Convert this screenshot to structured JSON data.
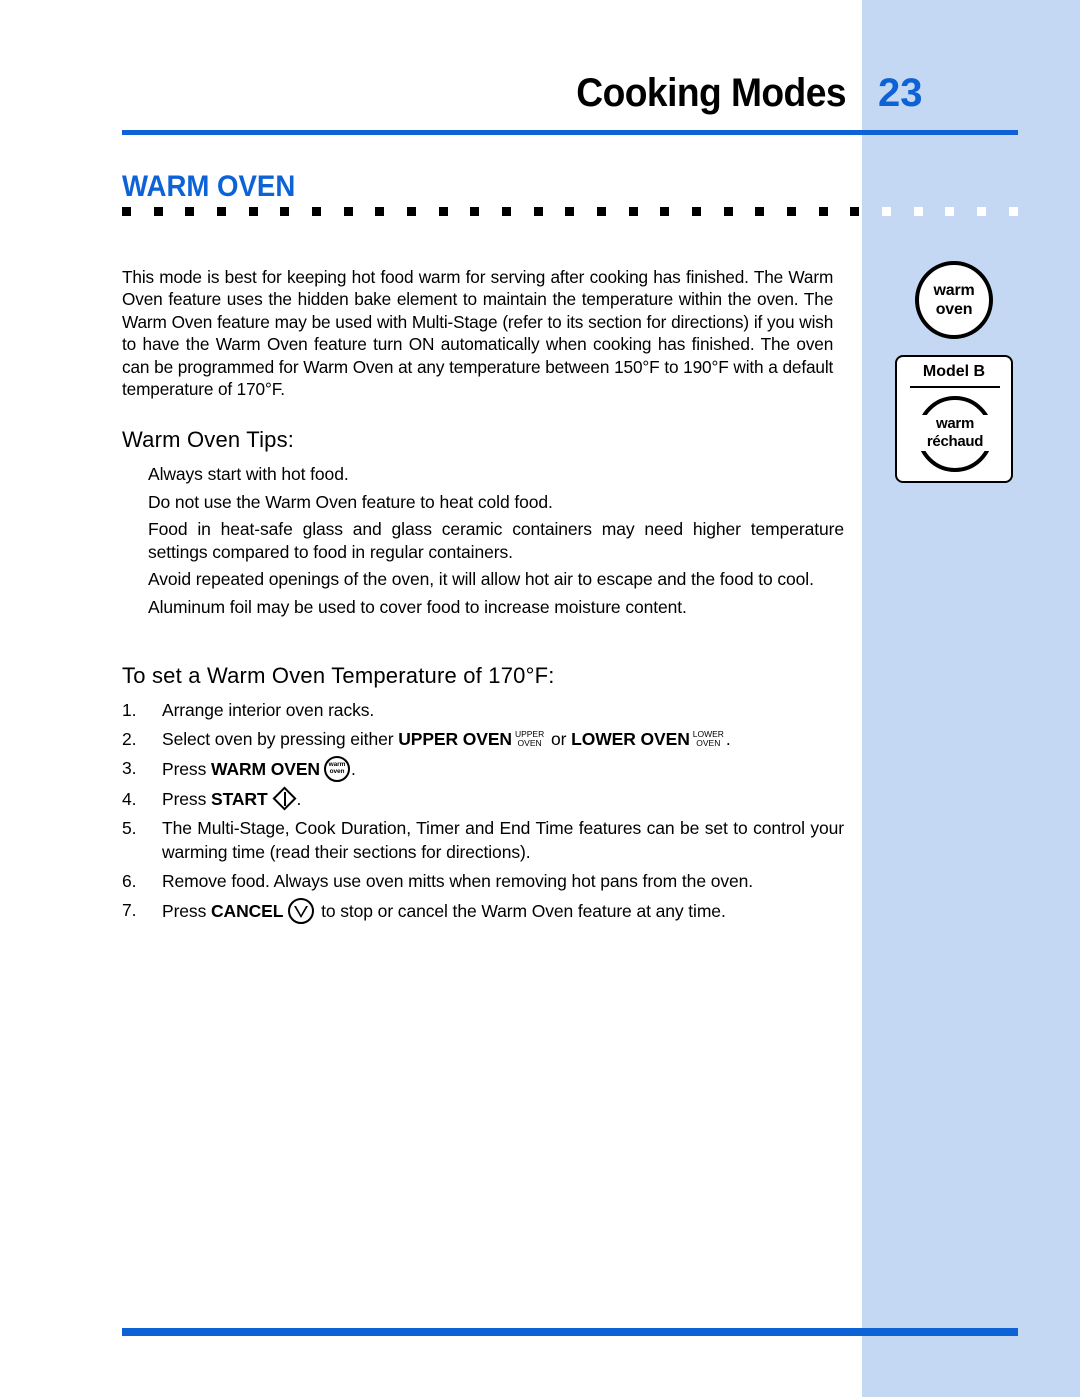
{
  "colors": {
    "accent_blue": "#0d63d6",
    "band_blue": "#c4d8f4",
    "text_black": "#000000"
  },
  "header": {
    "title": "Cooking Modes",
    "page_number": "23"
  },
  "section": {
    "title": "WARM OVEN",
    "intro": "This mode is best for keeping hot food warm for serving after cooking has finished. The Warm Oven feature uses the hidden bake element to maintain the temperature within the oven. The Warm Oven feature may be used with Multi-Stage (refer to its section for directions) if you wish to have the Warm Oven feature turn ON automatically when cooking has finished. The oven can be programmed for Warm Oven at any temperature between 150°F to 190°F with a default temperature of 170°F."
  },
  "tips": {
    "heading": "Warm Oven Tips:",
    "items": [
      "Always start with hot food.",
      "Do not use the Warm Oven feature to heat cold food.",
      "Food in heat-safe glass and glass ceramic containers may need higher temperature settings compared to food in regular containers.",
      "Avoid repeated openings of the oven, it will allow hot air to escape and the food to cool.",
      "Aluminum foil may be used to cover food to increase moisture content."
    ]
  },
  "procedure": {
    "heading": "To set a Warm Oven Temperature of 170°F:",
    "steps": [
      {
        "number": "1.",
        "text_before": "Arrange interior oven racks.",
        "bold": "",
        "text_after": ""
      },
      {
        "number": "2.",
        "text_before": "Select oven by pressing either ",
        "bold": "UPPER OVEN",
        "key_upper_line1": "UPPER",
        "key_upper_line2": "OVEN",
        "text_middle": " or ",
        "bold2": "LOWER OVEN",
        "key_lower_line1": "LOWER",
        "key_lower_line2": "OVEN",
        "text_after": "."
      },
      {
        "number": "3.",
        "text_before": "Press ",
        "bold": "WARM OVEN",
        "key_circle_line1": "warm",
        "key_circle_line2": "oven",
        "text_after": "."
      },
      {
        "number": "4.",
        "text_before": "Press ",
        "bold": "START",
        "text_after": "."
      },
      {
        "number": "5.",
        "text_before": "The Multi-Stage, Cook Duration, Timer and End Time features can be set to control your warming time (read their sections for directions).",
        "bold": "",
        "text_after": ""
      },
      {
        "number": "6.",
        "text_before": "Remove food. Always use oven mitts when removing hot pans from the oven.",
        "bold": "",
        "text_after": ""
      },
      {
        "number": "7.",
        "text_before": "Press ",
        "bold": "CANCEL",
        "text_after": " to stop or cancel the Warm Oven feature at any time."
      }
    ]
  },
  "sidebar": {
    "warm_oven_key": {
      "line1": "warm",
      "line2": "oven"
    },
    "model_box": {
      "label": "Model B",
      "key_line1": "warm",
      "key_line2": "réchaud"
    }
  }
}
